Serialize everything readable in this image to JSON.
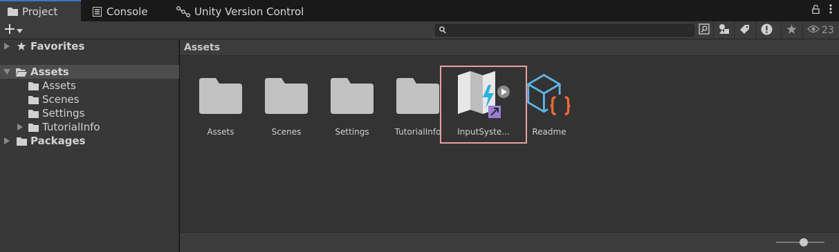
{
  "tabs": [
    {
      "label": "Project",
      "icon": "folder-icon",
      "active": true
    },
    {
      "label": "Console",
      "icon": "console-icon",
      "active": false
    },
    {
      "label": "Unity Version Control",
      "icon": "version-control-icon",
      "active": false
    }
  ],
  "toolbar": {
    "add_label": "+",
    "search_value": "",
    "hidden_count": "23"
  },
  "tree": {
    "favorites": "Favorites",
    "assets": "Assets",
    "assets_children": [
      "Assets",
      "Scenes",
      "Settings",
      "TutorialInfo"
    ],
    "packages": "Packages"
  },
  "main": {
    "breadcrumb": "Assets",
    "items": [
      {
        "label": "Assets",
        "type": "folder"
      },
      {
        "label": "Scenes",
        "type": "folder"
      },
      {
        "label": "Settings",
        "type": "folder"
      },
      {
        "label": "TutorialInfo",
        "type": "folder"
      },
      {
        "label": "InputSyste...",
        "type": "input-actions"
      },
      {
        "label": "Readme",
        "type": "readme"
      }
    ],
    "zoom_level": 0.57
  },
  "colors": {
    "active_tab_accent": "#3a79bb",
    "highlight_border": "#e8a0a0",
    "readme_blue": "#5fb5e8",
    "readme_orange": "#f06a3b"
  }
}
